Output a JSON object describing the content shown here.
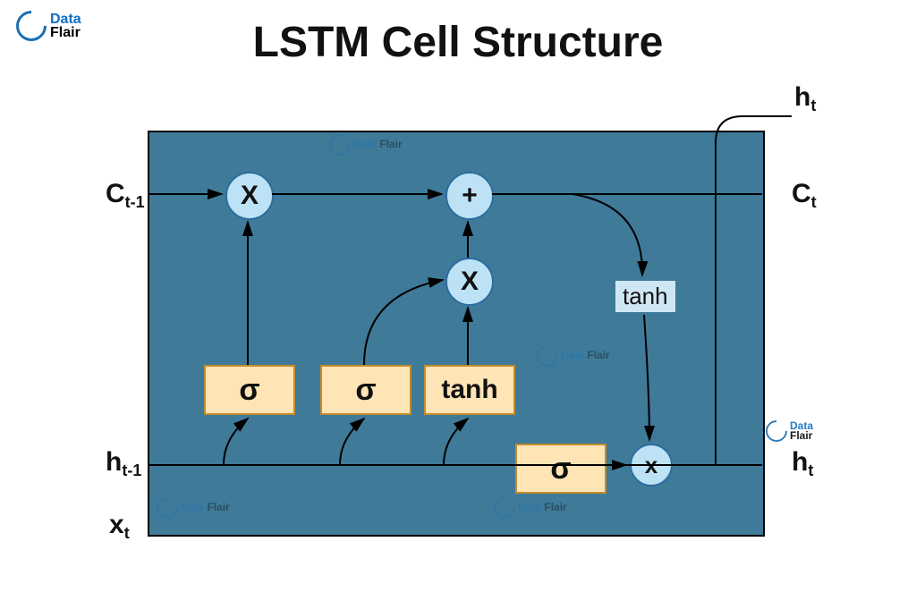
{
  "title": "LSTM Cell Structure",
  "brand": {
    "line1": "Data",
    "line2": "Flair"
  },
  "labels": {
    "c_prev": "C",
    "c_prev_sub": "t-1",
    "h_prev": "h",
    "h_prev_sub": "t-1",
    "x_t": "x",
    "x_t_sub": "t",
    "c_t": "C",
    "c_t_sub": "t",
    "h_t_top": "h",
    "h_t_top_sub": "t",
    "h_t_side": "h",
    "h_t_side_sub": "t"
  },
  "gates": {
    "sigma1": "σ",
    "sigma2": "σ",
    "tanh_gate": "tanh",
    "sigma3": "σ"
  },
  "ops": {
    "mul1": "X",
    "add": "+",
    "mul2": "X",
    "mul3": "x",
    "tanh_out": "tanh"
  }
}
